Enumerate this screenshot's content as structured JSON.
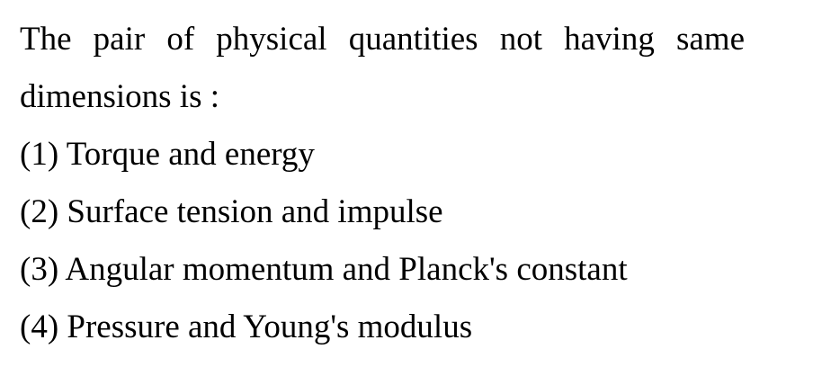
{
  "question": {
    "stem": "The pair of physical quantities not having same dimensions is :",
    "options": [
      "(1) Torque and energy",
      "(2) Surface tension and impulse",
      "(3) Angular momentum and Planck's constant",
      "(4) Pressure and Young's modulus"
    ]
  }
}
